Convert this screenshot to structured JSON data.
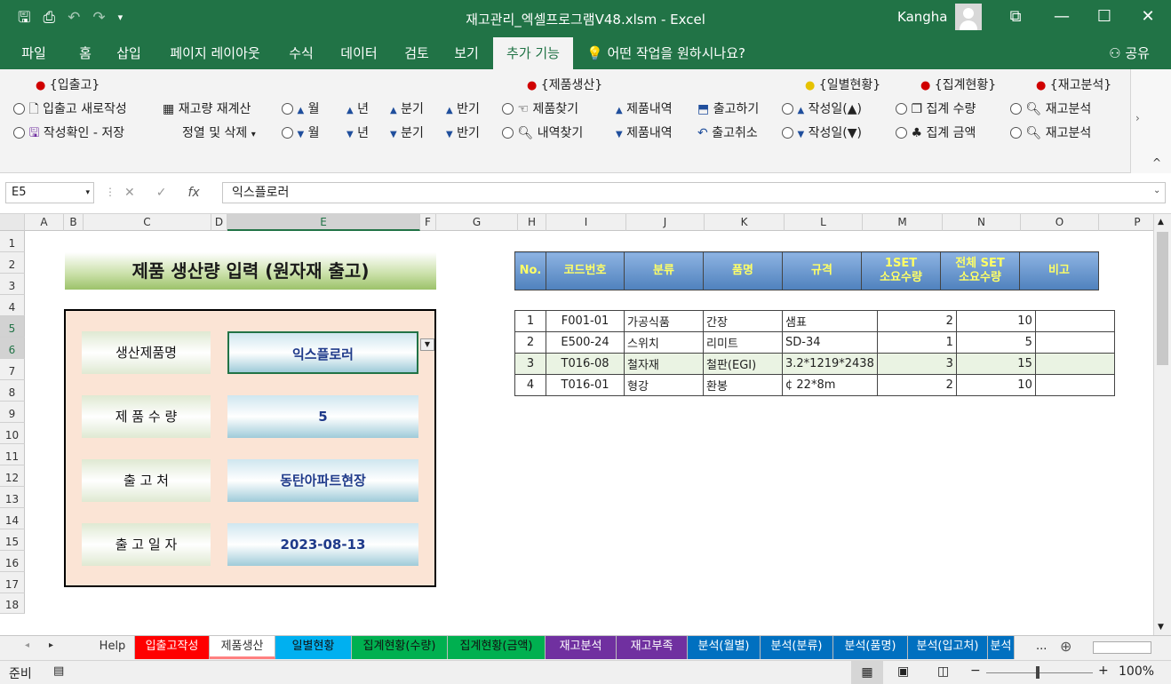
{
  "window": {
    "title": "재고관리_엑셀프로그램V48.xlsm  -  Excel",
    "user": "Kangha"
  },
  "ribbon_tabs": [
    "파일",
    "홈",
    "삽입",
    "페이지 레이아웃",
    "수식",
    "데이터",
    "검토",
    "보기",
    "추가 기능"
  ],
  "tell_me": "어떤 작업을 원하시나요?",
  "share": "공유",
  "ribbon": {
    "grp_inout": "{입출고}",
    "grp_product": "{제품생산}",
    "grp_daily": "{일별현황}",
    "grp_summary": "{집계현황}",
    "grp_stock": "{재고분석}",
    "new_inout": "입출고 새로작성",
    "recalc": "재고량 재계산",
    "save_check": "작성확인 - 저장",
    "sort_delete": "정열 및 삭제",
    "month": "월",
    "year": "년",
    "quarter": "분기",
    "half": "반기",
    "find_product": "제품찾기",
    "find_detail": "내역찾기",
    "product_detail": "제품내역",
    "ship": "출고하기",
    "cancel_ship": "출고취소",
    "date_up": "작성일(▲)",
    "date_down": "작성일(▼)",
    "sum_qty": "집계 수량",
    "sum_amt": "집계 금액",
    "stock_analysis": "재고분석"
  },
  "formula_bar": {
    "name_box": "E5",
    "content": "익스플로러"
  },
  "columns": [
    "A",
    "B",
    "C",
    "D",
    "E",
    "F",
    "G",
    "H",
    "I",
    "J",
    "K",
    "L",
    "M",
    "N",
    "O",
    "P"
  ],
  "rows": [
    "1",
    "2",
    "3",
    "4",
    "5",
    "6",
    "7",
    "8",
    "9",
    "10",
    "11",
    "12",
    "13",
    "14",
    "15",
    "16",
    "17",
    "18"
  ],
  "sheet": {
    "banner": "제품 생산량 입력 (원자재 출고)",
    "form": [
      {
        "label": "생산제품명",
        "value": "익스플로러"
      },
      {
        "label": "제 품 수 량",
        "value": "5"
      },
      {
        "label": "출   고   처",
        "value": "동탄아파트현장"
      },
      {
        "label": "출 고 일 자",
        "value": "2023-08-13"
      }
    ],
    "table_headers": [
      "No.",
      "코드번호",
      "분류",
      "품명",
      "규격",
      "1SET\n소요수량",
      "전체 SET\n소요수량",
      "비고"
    ],
    "table_rows": [
      [
        "1",
        "F001-01",
        "가공식품",
        "간장",
        "샘표",
        "2",
        "10",
        ""
      ],
      [
        "2",
        "E500-24",
        "스위치",
        "리미트",
        "SD-34",
        "1",
        "5",
        ""
      ],
      [
        "3",
        "T016-08",
        "철자재",
        "철판(EGI)",
        "3.2*1219*2438",
        "3",
        "15",
        ""
      ],
      [
        "4",
        "T016-01",
        "형강",
        "환봉",
        "¢ 22*8m",
        "2",
        "10",
        ""
      ]
    ]
  },
  "sheet_tabs": [
    {
      "label": "Help",
      "color": "#f0f0f0",
      "text": "#333"
    },
    {
      "label": "입출고작성",
      "color": "#ff0000",
      "text": "#fff"
    },
    {
      "label": "제품생산",
      "color": "#ffffff",
      "text": "#333"
    },
    {
      "label": "일별현황",
      "color": "#00b0f0",
      "text": "#111"
    },
    {
      "label": "집계현황(수량)",
      "color": "#00b050",
      "text": "#111"
    },
    {
      "label": "집계현황(금액)",
      "color": "#00b050",
      "text": "#111"
    },
    {
      "label": "재고분석",
      "color": "#7030a0",
      "text": "#fff"
    },
    {
      "label": "재고부족",
      "color": "#7030a0",
      "text": "#fff"
    },
    {
      "label": "분석(월별)",
      "color": "#0070c0",
      "text": "#fff"
    },
    {
      "label": "분석(분류)",
      "color": "#0070c0",
      "text": "#fff"
    },
    {
      "label": "분석(품명)",
      "color": "#0070c0",
      "text": "#fff"
    },
    {
      "label": "분석(입고처)",
      "color": "#0070c0",
      "text": "#fff"
    },
    {
      "label": "분석",
      "color": "#0070c0",
      "text": "#fff"
    }
  ],
  "status": {
    "ready": "준비",
    "zoom": "100%"
  }
}
